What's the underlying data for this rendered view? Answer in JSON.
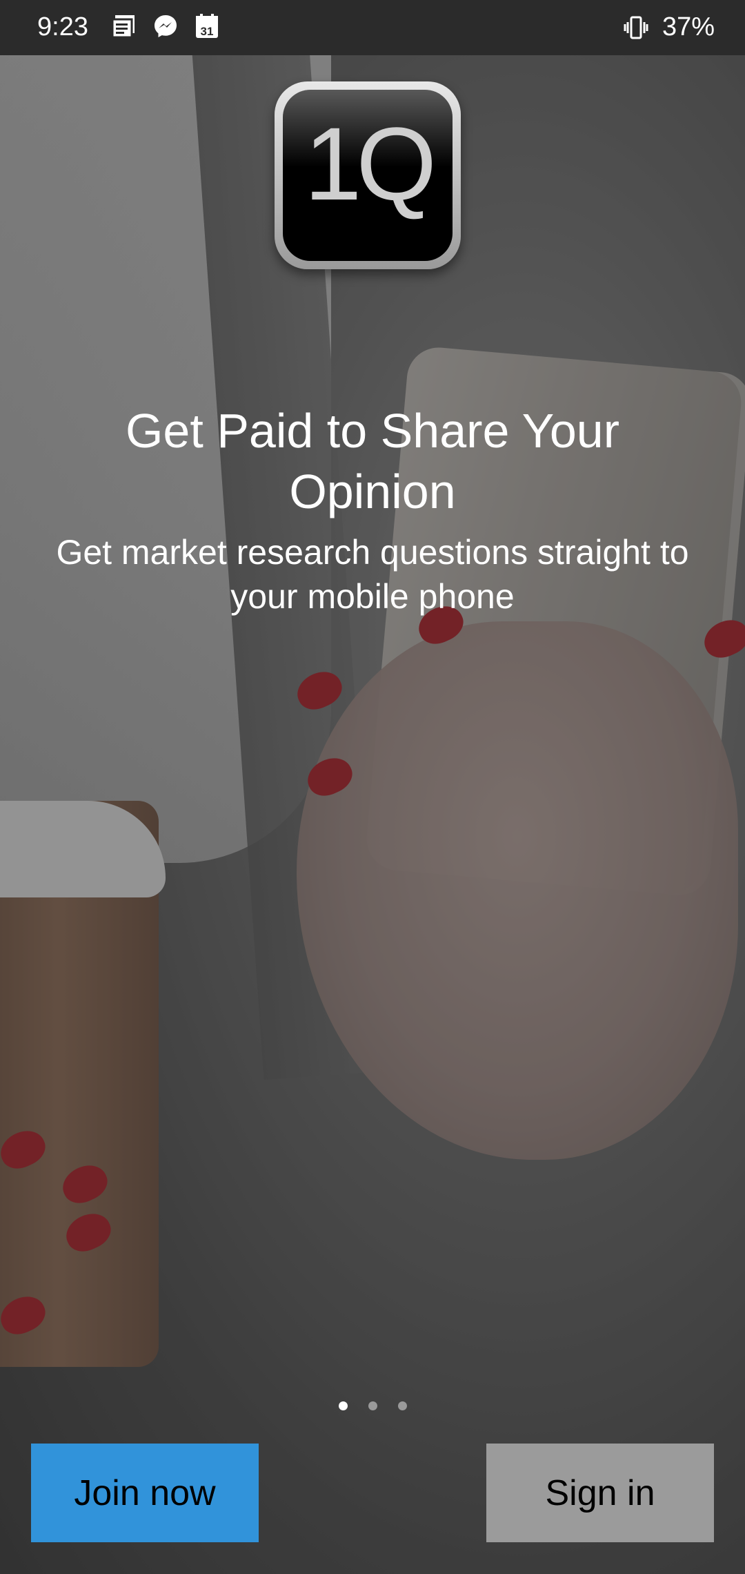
{
  "status_bar": {
    "time": "9:23",
    "icons": [
      "news-icon",
      "messenger-icon",
      "calendar-icon"
    ],
    "calendar_day": "31",
    "vibrate_icon": "vibrate-icon",
    "battery": "37%"
  },
  "logo": {
    "text": "1Q"
  },
  "hero": {
    "title": "Get Paid to Share Your Opinion",
    "subtitle": "Get market research questions straight to your mobile phone"
  },
  "pager": {
    "count": 3,
    "active_index": 0
  },
  "buttons": {
    "join": "Join now",
    "sign_in": "Sign in"
  },
  "colors": {
    "join_button": "#3193da",
    "sign_in_button": "#9b9b9b",
    "status_bar": "#2b2b2b"
  }
}
